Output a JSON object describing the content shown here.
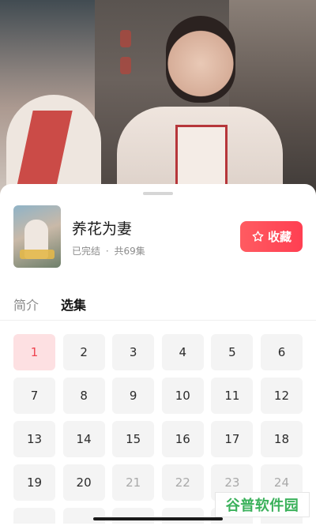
{
  "video": {},
  "drama": {
    "title": "养花为妻",
    "status": "已完结",
    "separator": "·",
    "episode_count": "共69集",
    "favorite_label": "收藏"
  },
  "tabs": {
    "intro": "简介",
    "episodes": "选集"
  },
  "episodes": [
    {
      "num": "1",
      "state": "current"
    },
    {
      "num": "2",
      "state": "normal"
    },
    {
      "num": "3",
      "state": "normal"
    },
    {
      "num": "4",
      "state": "normal"
    },
    {
      "num": "5",
      "state": "normal"
    },
    {
      "num": "6",
      "state": "normal"
    },
    {
      "num": "7",
      "state": "normal"
    },
    {
      "num": "8",
      "state": "normal"
    },
    {
      "num": "9",
      "state": "normal"
    },
    {
      "num": "10",
      "state": "normal"
    },
    {
      "num": "11",
      "state": "normal"
    },
    {
      "num": "12",
      "state": "normal"
    },
    {
      "num": "13",
      "state": "normal"
    },
    {
      "num": "14",
      "state": "normal"
    },
    {
      "num": "15",
      "state": "normal"
    },
    {
      "num": "16",
      "state": "normal"
    },
    {
      "num": "17",
      "state": "normal"
    },
    {
      "num": "18",
      "state": "normal"
    },
    {
      "num": "19",
      "state": "normal"
    },
    {
      "num": "20",
      "state": "normal"
    },
    {
      "num": "21",
      "state": "locked"
    },
    {
      "num": "22",
      "state": "locked"
    },
    {
      "num": "23",
      "state": "locked"
    },
    {
      "num": "24",
      "state": "locked"
    }
  ],
  "watermark": "谷普软件园",
  "colors": {
    "accent": "#ff4a57",
    "current_bg": "#fde0e2",
    "tile_bg": "#f4f4f4"
  },
  "icons": {
    "favorite": "star-outline-icon"
  }
}
